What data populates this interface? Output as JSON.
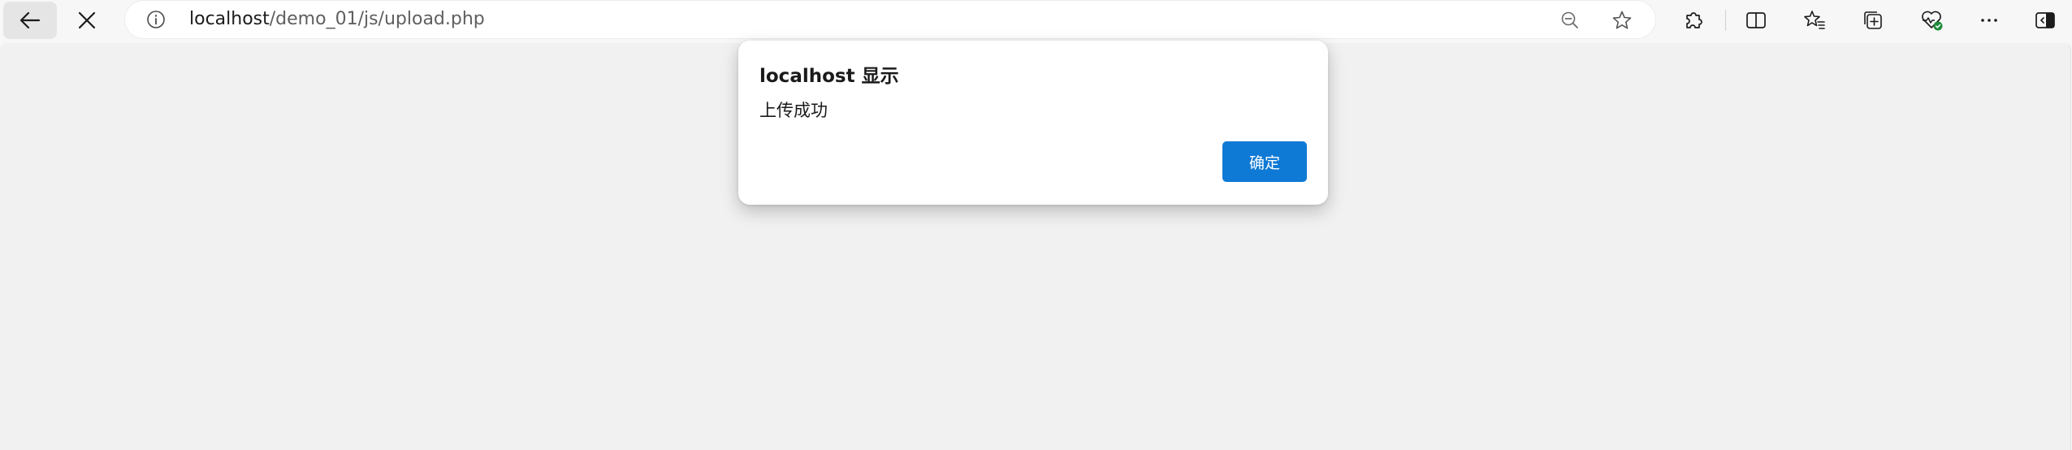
{
  "browser": {
    "url_host": "localhost",
    "url_path": "/demo_01/js/upload.php",
    "icons": {
      "back": "back-arrow-icon",
      "stop": "close-icon",
      "site_info": "info-icon",
      "zoom": "zoom-out-icon",
      "favorite": "star-icon",
      "extensions": "puzzle-icon",
      "split_screen": "split-screen-icon",
      "favorites": "favorites-icon",
      "collections": "collections-icon",
      "performance": "browser-essentials-icon",
      "more": "more-icon",
      "sidebar": "sidebar-icon"
    },
    "accent_color": "#0f7ad5",
    "status_color": "#1e8c3a"
  },
  "dialog": {
    "title": "localhost 显示",
    "message": "上传成功",
    "ok_label": "确定"
  }
}
